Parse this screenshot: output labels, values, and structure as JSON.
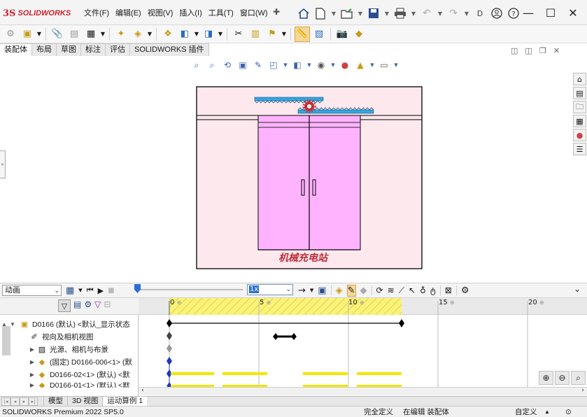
{
  "app": {
    "logo_mark": "3S",
    "logo_text": "SOLIDWORKS",
    "menus": [
      "文件(F)",
      "编辑(E)",
      "视图(V)",
      "插入(I)",
      "工具(T)",
      "窗口(W)"
    ],
    "pin_icon": "pin-icon",
    "window_controls": [
      "minimize-icon",
      "maximize-icon",
      "close-icon"
    ],
    "overflow_label": "D"
  },
  "tabs": {
    "items": [
      "装配体",
      "布局",
      "草图",
      "标注",
      "评估",
      "SOLIDWORKS 插件"
    ],
    "active": "装配体"
  },
  "viewport": {
    "bg_color": "#fde8ee",
    "frame_color": "#000000",
    "cabinet_color": "#ffb3ff",
    "rack_color": "#34a5e0",
    "gear_color": "#c0303a",
    "caption": "机械充电站",
    "caption_color": "#c0303a"
  },
  "motion": {
    "study_type": "动画",
    "speed": "1x",
    "timeline_labels": [
      "0",
      "5",
      "10",
      "15",
      "20"
    ],
    "tree": [
      {
        "label": "D0166 (默认) <默认_显示状态",
        "icon": "assembly-icon",
        "expanded": true
      },
      {
        "label": "视向及相机视图",
        "icon": "camera-icon"
      },
      {
        "label": "光源、相机与布景",
        "icon": "lights-icon"
      },
      {
        "label": "(固定) D0166-006<1> (默",
        "icon": "part-icon"
      },
      {
        "label": "D0166-02<1> (默认) <默",
        "icon": "part-icon"
      },
      {
        "label": "D0166-01<1> (默认) <默",
        "icon": "part-icon"
      }
    ]
  },
  "bottom_tabs": {
    "items": [
      "模型",
      "3D 视图",
      "运动算例 1"
    ],
    "active": "运动算例 1"
  },
  "status": {
    "product": "SOLIDWORKS Premium 2022 SP5.0",
    "state": "完全定义",
    "editing": "在编辑 装配体",
    "custom": "自定义"
  }
}
